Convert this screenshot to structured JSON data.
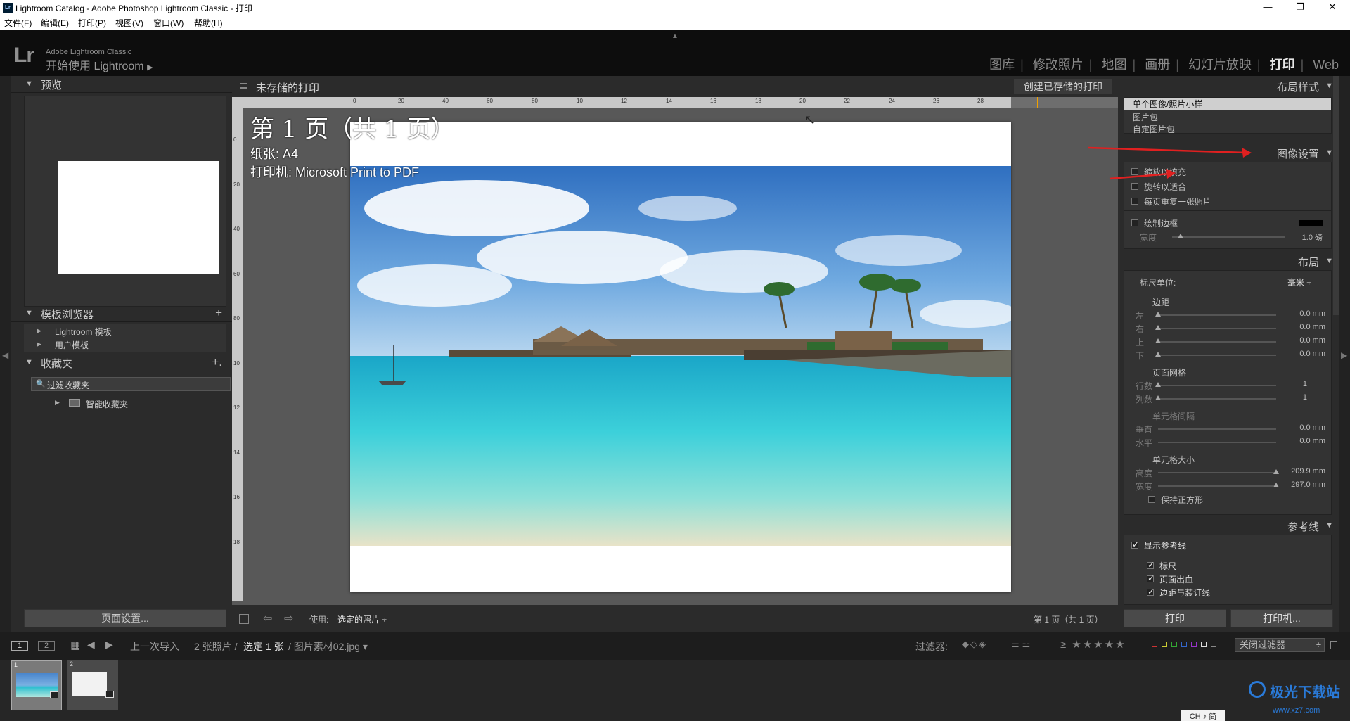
{
  "window": {
    "title": "Lightroom Catalog - Adobe Photoshop Lightroom Classic - 打印",
    "app_icon": "Lr"
  },
  "menu": [
    "文件(F)",
    "编辑(E)",
    "打印(P)",
    "视图(V)",
    "窗口(W)",
    "帮助(H)"
  ],
  "identity": {
    "logo": "Lr",
    "product": "Adobe Lightroom Classic",
    "get_started": "开始使用 Lightroom"
  },
  "modules": [
    "图库",
    "修改照片",
    "地图",
    "画册",
    "幻灯片放映",
    "打印",
    "Web"
  ],
  "active_module": "打印",
  "left_panel": {
    "preview": "预览",
    "template_browser": "模板浏览器",
    "templates": [
      "Lightroom 模板",
      "用户模板"
    ],
    "collections": "收藏夹",
    "filter_placeholder": "过滤收藏夹",
    "smart_collections": "智能收藏夹",
    "page_setup": "页面设置..."
  },
  "center": {
    "unsaved_title": "未存储的打印",
    "create_saved": "创建已存储的打印",
    "page_label": "第 1 页（共 1 页）",
    "paper_label": "纸张: A4",
    "printer_label": "打印机: Microsoft Print to PDF",
    "use_label": "使用:",
    "use_value": "选定的照片",
    "page_count": "第 1 页（共 1 页）",
    "ruler_top": [
      "0",
      "20",
      "40",
      "60",
      "80",
      "10",
      "12",
      "14",
      "16",
      "18",
      "20",
      "22",
      "24",
      "26",
      "28"
    ],
    "ruler_left": [
      "0",
      "20",
      "40",
      "60",
      "80",
      "10",
      "12",
      "14",
      "16",
      "18"
    ]
  },
  "right_panel": {
    "layout_style": "布局样式",
    "layout_options": [
      "单个图像/照片小样",
      "图片包",
      "自定图片包"
    ],
    "image_settings": "图像设置",
    "image_checks": [
      {
        "label": "缩放以填充",
        "checked": false
      },
      {
        "label": "旋转以适合",
        "checked": false
      },
      {
        "label": "每页重复一张照片",
        "checked": false
      }
    ],
    "draw_border": "绘制边框",
    "border_width_label": "宽度",
    "border_width_value": "1.0 磅",
    "layout": "布局",
    "ruler_units_label": "标尺单位:",
    "ruler_units_value": "毫米 ÷",
    "margins_title": "边距",
    "margins": [
      {
        "label": "左",
        "value": "0.0 mm"
      },
      {
        "label": "右",
        "value": "0.0 mm"
      },
      {
        "label": "上",
        "value": "0.0 mm"
      },
      {
        "label": "下",
        "value": "0.0 mm"
      }
    ],
    "grid_title": "页面网格",
    "grid": [
      {
        "label": "行数",
        "value": "1"
      },
      {
        "label": "列数",
        "value": "1"
      }
    ],
    "spacing_title": "单元格间隔",
    "spacing": [
      {
        "label": "垂直",
        "value": "0.0 mm"
      },
      {
        "label": "水平",
        "value": "0.0 mm"
      }
    ],
    "cellsize_title": "单元格大小",
    "cellsize": [
      {
        "label": "高度",
        "value": "209.9 mm"
      },
      {
        "label": "宽度",
        "value": "297.0 mm"
      }
    ],
    "keep_square": "保持正方形",
    "guides": "参考线",
    "show_guides": "显示参考线",
    "guide_items": [
      "标尺",
      "页面出血",
      "边距与装订线"
    ],
    "print": "打印",
    "printer": "打印机..."
  },
  "filmbar": {
    "page1": "1",
    "page2": "2",
    "source": "上一次导入",
    "count": "2 张照片 /",
    "selected": "选定 1 张",
    "filename": "/ 图片素材02.jpg",
    "filter_label": "过滤器:",
    "filter_off": "关闭过滤器"
  },
  "film_thumbs": [
    "1",
    "2"
  ],
  "watermark": {
    "name": "极光下载站",
    "url": "www.xz7.com",
    "ime": "CH ♪ 简"
  }
}
